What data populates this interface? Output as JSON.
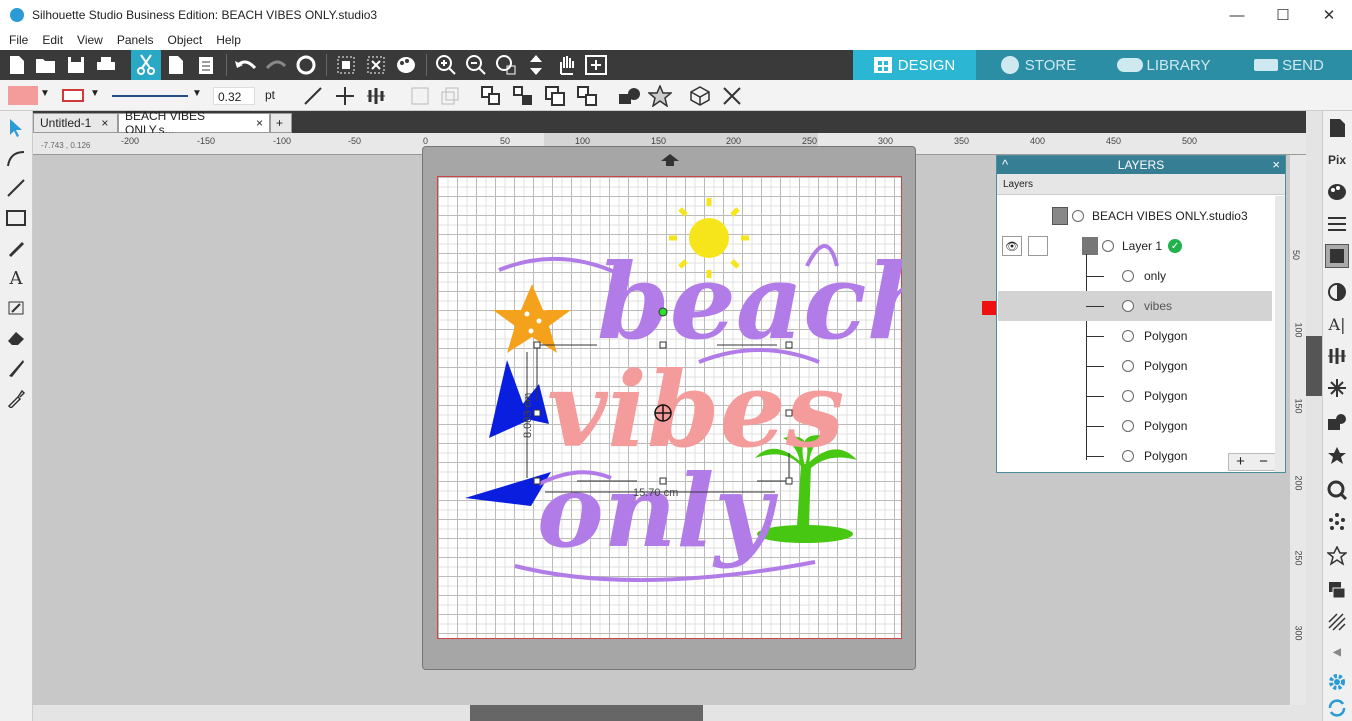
{
  "window": {
    "title": "Silhouette Studio Business Edition: BEACH VIBES ONLY.studio3",
    "minimize": "—",
    "maximize": "☐",
    "close": "✕"
  },
  "menu": [
    "File",
    "Edit",
    "View",
    "Panels",
    "Object",
    "Help"
  ],
  "tabs": [
    {
      "label": "DESIGN",
      "active": true
    },
    {
      "label": "STORE",
      "active": false
    },
    {
      "label": "LIBRARY",
      "active": false
    },
    {
      "label": "SEND",
      "active": false
    }
  ],
  "line_style": {
    "width_value": "0.32",
    "unit": "pt"
  },
  "colors": {
    "fill": "#f49c9c",
    "line": "#d23a3a",
    "accent": "#2bb6d4"
  },
  "documents": [
    {
      "name": "Untitled-1",
      "close": "×"
    },
    {
      "name": "BEACH VIBES ONLY.s...",
      "close": "×"
    }
  ],
  "add_tab": "+",
  "ruler": {
    "coords": "-7.743 , 0.126",
    "top_ticks": [
      "-200",
      "-150",
      "-100",
      "-50",
      "0",
      "50",
      "100",
      "150",
      "200",
      "250",
      "300",
      "350",
      "400",
      "450",
      "500"
    ],
    "side_ticks": [
      "50",
      "100",
      "150",
      "200",
      "250",
      "300"
    ]
  },
  "canvas": {
    "width_label": "15.70 cm",
    "height_label": "8.083 cm",
    "design_words": [
      "beach",
      "vibes",
      "only"
    ]
  },
  "layers_panel": {
    "title": "LAYERS",
    "close": "×",
    "collapse": "^",
    "subheader": "Layers",
    "document": "BEACH VIBES ONLY.studio3",
    "layer": "Layer 1",
    "items": [
      "only",
      "vibes",
      "Polygon",
      "Polygon",
      "Polygon",
      "Polygon",
      "Polygon"
    ],
    "selected_index": 1,
    "add": "+",
    "remove": "−"
  },
  "left_tools": [
    "select-icon",
    "point-edit-icon",
    "line-icon",
    "rectangle-icon",
    "pencil-icon",
    "text-icon",
    "eraser-icon",
    "knife-icon",
    "eyedropper-icon"
  ],
  "left_tool_glyphs": {
    "text": "A"
  },
  "right_tools": [
    "page-icon",
    "pixscan-icon",
    "palette-icon",
    "line-style-icon",
    "fill-icon",
    "contrast-icon",
    "text-style-icon",
    "align-icon",
    "replicate-icon",
    "modify-icon",
    "star-icon",
    "trace-icon",
    "dots-icon",
    "outline-star-icon",
    "layers-icon",
    "hatch-icon",
    "settings-icon",
    "refresh-icon"
  ],
  "right_tool_glyphs": {
    "pix": "Pix",
    "text": "A|"
  }
}
